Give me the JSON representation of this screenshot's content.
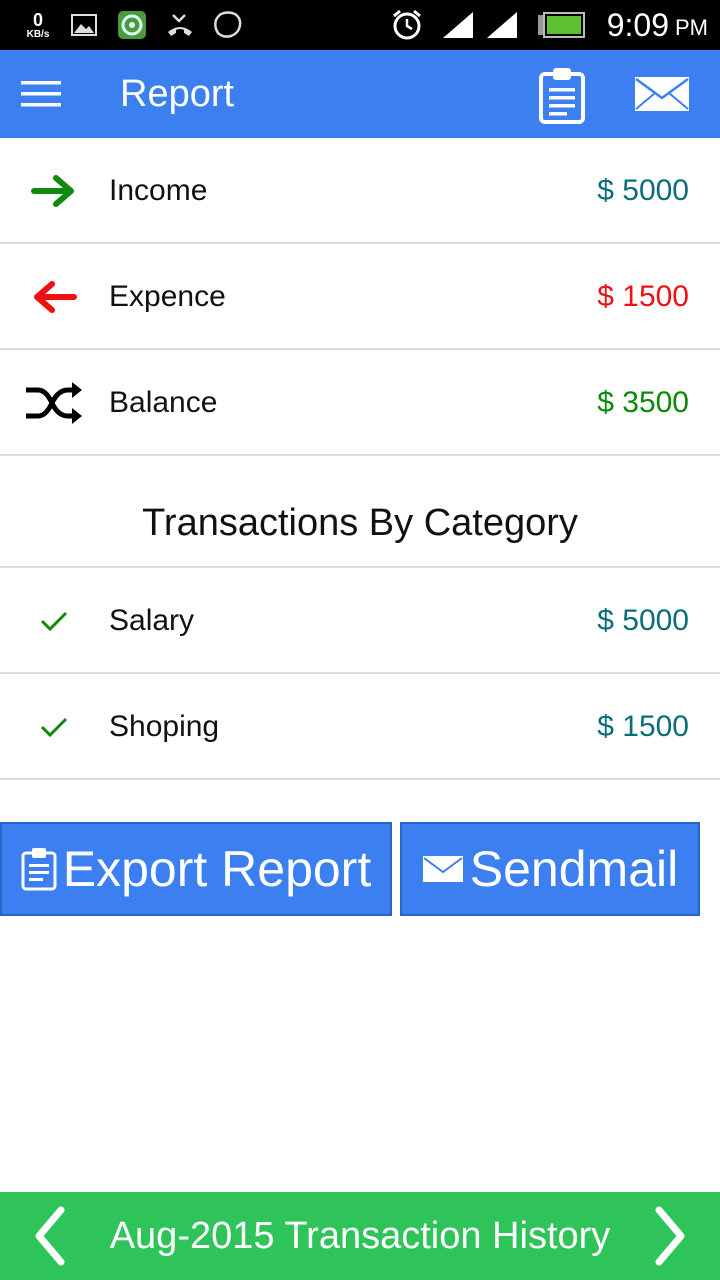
{
  "status_bar": {
    "speed_value": "0",
    "speed_unit": "KB/s",
    "time": "9:09",
    "ampm": "PM",
    "icons": [
      "image-icon",
      "camera-app-icon",
      "missed-call-icon",
      "chat-icon",
      "alarm-icon",
      "signal-icon",
      "signal-icon",
      "battery-icon"
    ]
  },
  "app_bar": {
    "title": "Report",
    "menu_icon": "hamburger-menu-icon",
    "export_icon": "clipboard-icon",
    "mail_icon": "envelope-icon"
  },
  "summary": [
    {
      "label": "Income",
      "amount": "$ 5000",
      "icon": "arrow-right-icon",
      "color": "#0a6e7a"
    },
    {
      "label": "Expence",
      "amount": "$ 1500",
      "icon": "arrow-left-icon",
      "color": "#ee1111"
    },
    {
      "label": "Balance",
      "amount": "$ 3500",
      "icon": "shuffle-icon",
      "color": "#0a8a0a"
    }
  ],
  "categories": {
    "title": "Transactions By Category",
    "items": [
      {
        "label": "Salary",
        "amount": "$ 5000",
        "icon": "check-icon"
      },
      {
        "label": "Shoping",
        "amount": "$ 1500",
        "icon": "check-icon"
      }
    ]
  },
  "buttons": {
    "export_label": "Export Report",
    "send_label": "Sendmail"
  },
  "bottom_bar": {
    "title": "Aug-2015 Transaction History"
  },
  "colors": {
    "primary": "#3b7ff0",
    "bottom_bar": "#2fc45a",
    "income_arrow": "#0f8a0f",
    "expense_arrow": "#ee1111",
    "category_amount": "#0a6e7a"
  }
}
